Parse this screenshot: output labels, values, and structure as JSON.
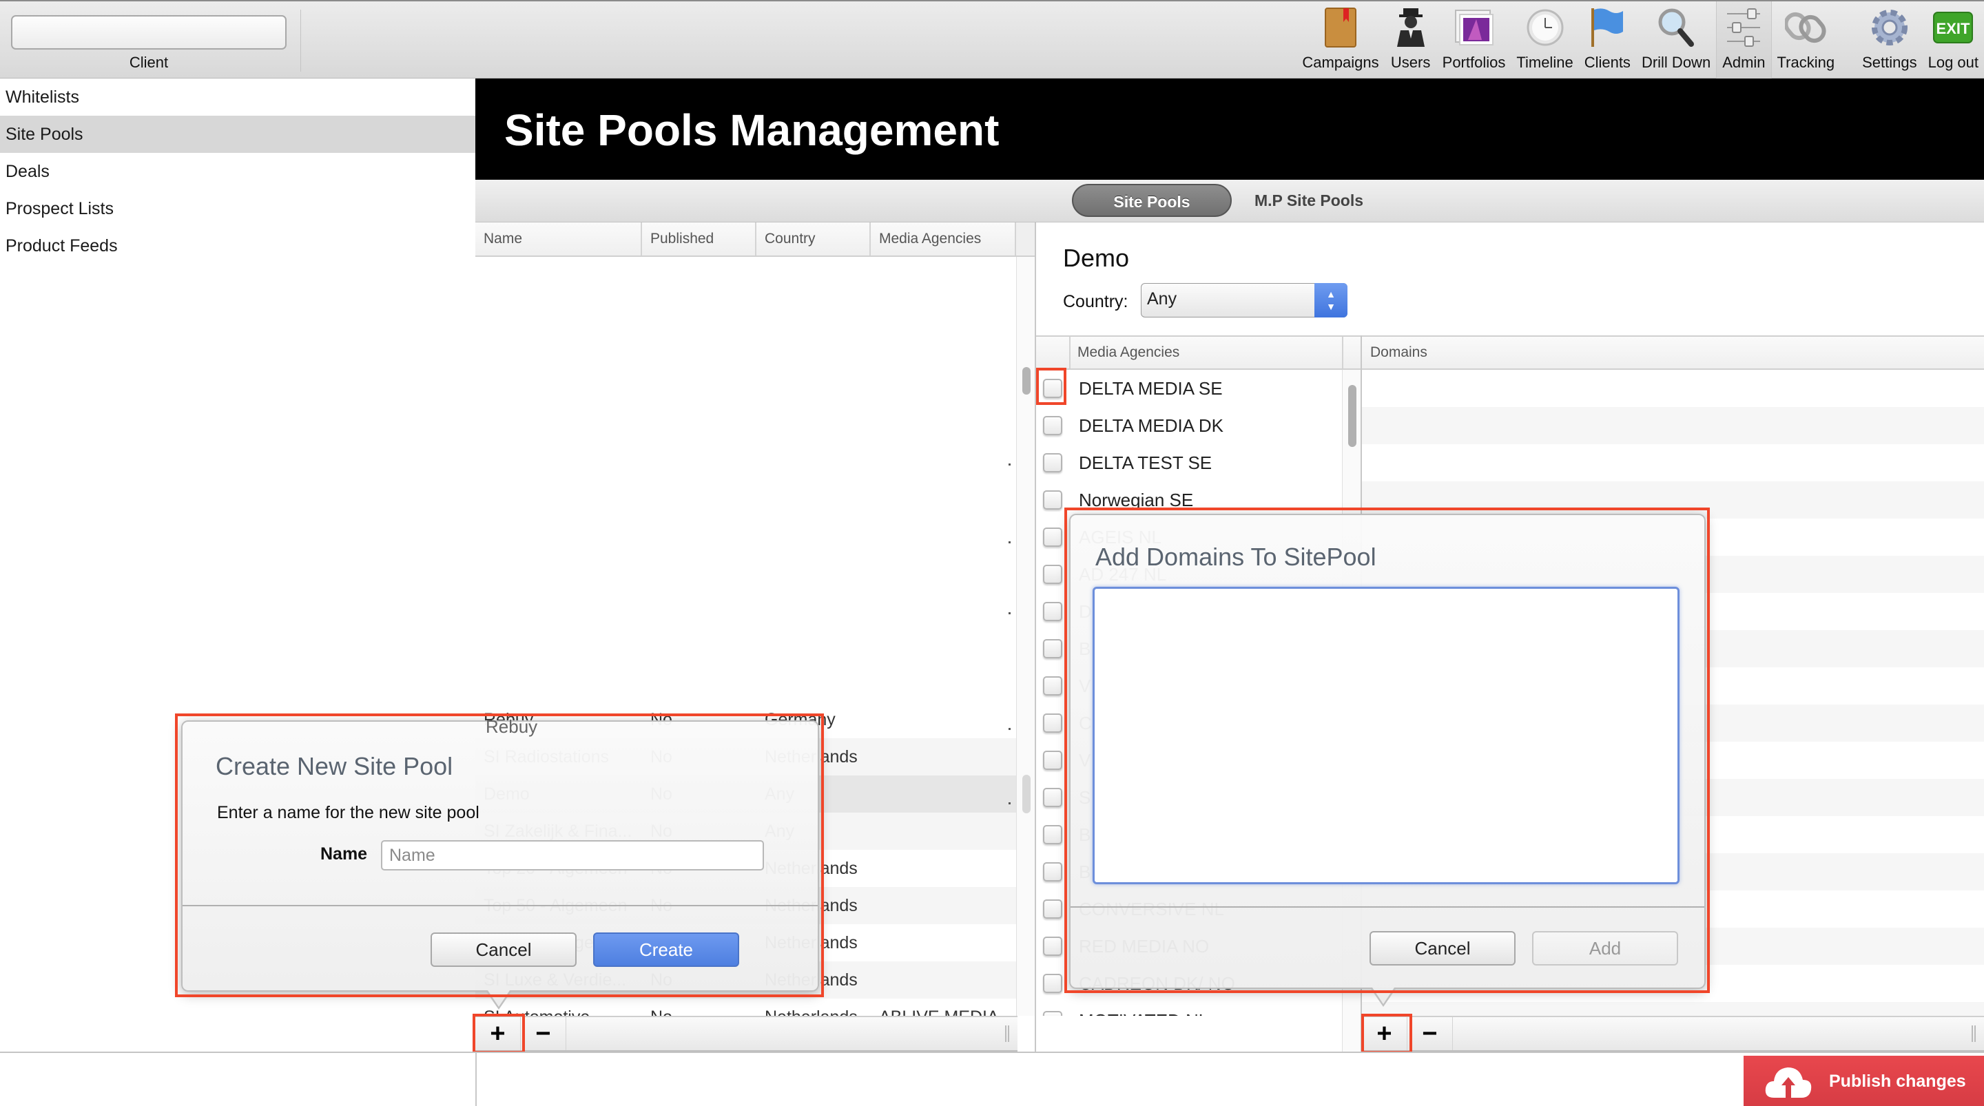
{
  "topbar": {
    "client_value": "",
    "client_label": "Client",
    "nav": [
      {
        "label": "Campaigns",
        "icon": "book-icon"
      },
      {
        "label": "Users",
        "icon": "user-icon"
      },
      {
        "label": "Portfolios",
        "icon": "portfolio-icon"
      },
      {
        "label": "Timeline",
        "icon": "clock-icon"
      },
      {
        "label": "Clients",
        "icon": "flag-icon"
      },
      {
        "label": "Drill Down",
        "icon": "magnifier-icon"
      },
      {
        "label": "Admin",
        "icon": "sliders-icon",
        "active": true
      },
      {
        "label": "Tracking",
        "icon": "chain-link-icon"
      },
      {
        "label": "Settings",
        "icon": "gear-icon"
      },
      {
        "label": "Log out",
        "icon": "exit-icon",
        "badge": "EXIT"
      }
    ]
  },
  "sidebar": {
    "items": [
      {
        "label": "Whitelists"
      },
      {
        "label": "Site Pools",
        "selected": true
      },
      {
        "label": "Deals"
      },
      {
        "label": "Prospect Lists"
      },
      {
        "label": "Product Feeds"
      }
    ]
  },
  "header": {
    "title": "Site Pools Management"
  },
  "tabs": [
    {
      "label": "Site Pools",
      "active": true
    },
    {
      "label": "M.P Site Pools"
    }
  ],
  "sitepools_table": {
    "columns": [
      "Name",
      "Published",
      "Country",
      "Media Agencies"
    ],
    "rows": [
      {
        "name": "Rebuy",
        "published": "No",
        "country": "Germany",
        "agencies": ""
      },
      {
        "name": "SI Radiostations",
        "published": "No",
        "country": "Netherlands",
        "agencies": ""
      },
      {
        "name": "Demo",
        "published": "No",
        "country": "Any",
        "agencies": "",
        "selected": true
      },
      {
        "name": "SI Zakelijk & Fina...",
        "published": "No",
        "country": "Any",
        "agencies": ""
      },
      {
        "name": "Top 20 - Algemeen",
        "published": "No",
        "country": "Netherlands",
        "agencies": ""
      },
      {
        "name": "Top 50 - Algemeen",
        "published": "No",
        "country": "Netherlands",
        "agencies": ""
      },
      {
        "name": "Top 100 - Algemeen",
        "published": "No",
        "country": "Netherlands",
        "agencies": ""
      },
      {
        "name": "SI Luxe & Verdie...",
        "published": "No",
        "country": "Netherlands",
        "agencies": ""
      },
      {
        "name": "SI Automotive",
        "published": "No",
        "country": "Netherlands",
        "agencies": "ABLIVE MEDIA"
      }
    ],
    "toolbar": {
      "add": "+",
      "remove": "−"
    }
  },
  "detail": {
    "title": "Demo",
    "country_label": "Country:",
    "country_value": "Any",
    "agencies_header": "Media Agencies",
    "domains_header": "Domains",
    "agencies": [
      {
        "name": "DELTA MEDIA SE",
        "checked": false
      },
      {
        "name": "DELTA MEDIA DK",
        "checked": false
      },
      {
        "name": "DELTA TEST SE",
        "checked": false
      },
      {
        "name": "Norwegian SE",
        "checked": false
      },
      {
        "name": "AGEIS NL",
        "checked": false
      },
      {
        "name": "AD 247 NL",
        "checked": false
      },
      {
        "name": "D",
        "checked": false
      },
      {
        "name": "B",
        "checked": false
      },
      {
        "name": "V",
        "checked": false
      },
      {
        "name": "C",
        "checked": false
      },
      {
        "name": "V",
        "checked": false
      },
      {
        "name": "S",
        "checked": false
      },
      {
        "name": "B",
        "checked": false
      },
      {
        "name": "B",
        "checked": false
      },
      {
        "name": "CONVERSIVE NL",
        "checked": false
      },
      {
        "name": "RED MEDIA NO",
        "checked": false
      },
      {
        "name": "CADREON DK/ NO",
        "checked": false
      },
      {
        "name": "MOTIVATED NL",
        "checked": false
      }
    ],
    "toolbar": {
      "add": "+",
      "remove": "−"
    }
  },
  "create_dialog": {
    "title": "Create New Site Pool",
    "prompt": "Enter a name for the new site pool",
    "name_label": "Name",
    "name_value": "",
    "name_placeholder": "Name",
    "cancel": "Cancel",
    "create": "Create"
  },
  "add_domains_dialog": {
    "title": "Add Domains To SitePool",
    "textarea_value": "",
    "cancel": "Cancel",
    "add": "Add"
  },
  "footer": {
    "publish": "Publish changes"
  },
  "colors": {
    "highlight": "#f0462a",
    "primary_button": "#5a88e6",
    "publish": "#e0434a",
    "header_bg": "#000000"
  }
}
